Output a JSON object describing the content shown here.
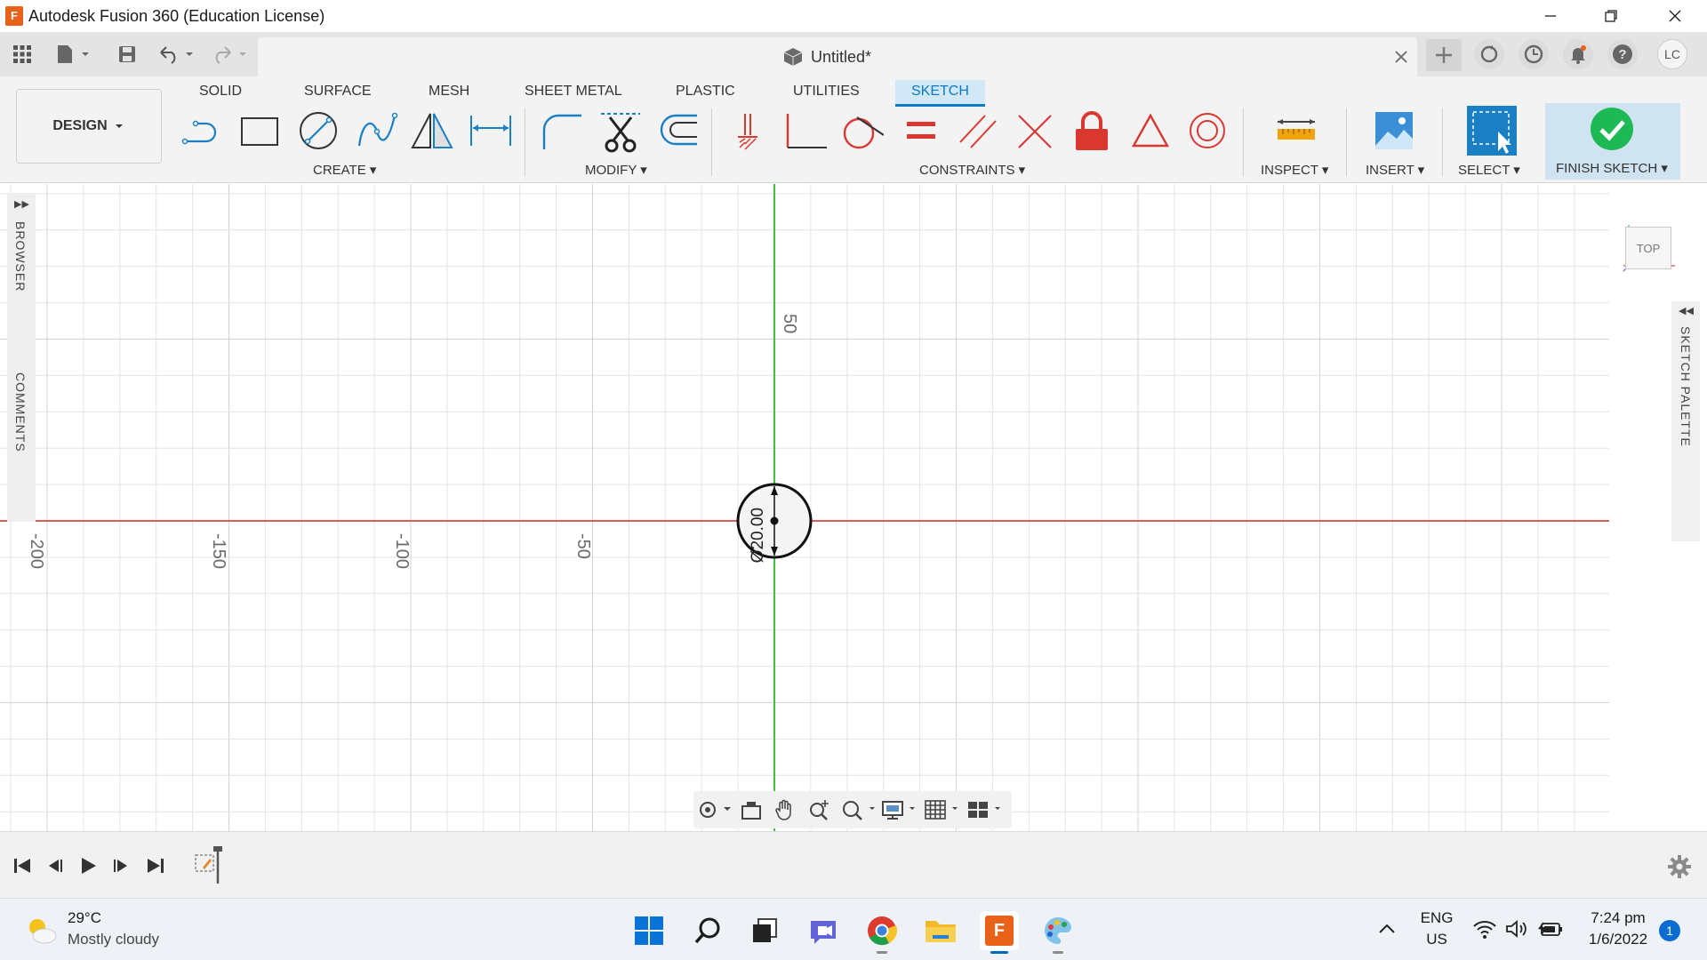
{
  "window": {
    "title": "Autodesk Fusion 360 (Education License)",
    "app_icon_letter": "F"
  },
  "tabbar": {
    "document_name": "Untitled*",
    "user_initials": "LC"
  },
  "ribbon": {
    "workspace": "DESIGN",
    "tabs": [
      {
        "label": "SOLID",
        "active": false
      },
      {
        "label": "SURFACE",
        "active": false
      },
      {
        "label": "MESH",
        "active": false
      },
      {
        "label": "SHEET METAL",
        "active": false
      },
      {
        "label": "PLASTIC",
        "active": false
      },
      {
        "label": "UTILITIES",
        "active": false
      },
      {
        "label": "SKETCH",
        "active": true
      }
    ],
    "groups": {
      "create": "CREATE",
      "modify": "MODIFY",
      "constraints": "CONSTRAINTS",
      "inspect": "INSPECT",
      "insert": "INSERT",
      "select": "SELECT",
      "finish": "FINISH SKETCH"
    },
    "colors": {
      "accent": "#0a7bc2",
      "constraint_red": "#d9372f",
      "finish_green": "#1db954"
    }
  },
  "canvas": {
    "browser_label": "BROWSER",
    "comments_label": "COMMENTS",
    "sketch_palette_label": "SKETCH PALETTE",
    "view_cube_label": "TOP",
    "axis_ticks": {
      "x": [
        "-200",
        "-150",
        "-100",
        "-50"
      ],
      "y": [
        "50"
      ]
    },
    "dimension_label": "Ø20.00",
    "colors": {
      "x_axis": "#e05a5a",
      "y_axis": "#3fc43f",
      "grid": "#e4e4e4"
    }
  },
  "taskbar": {
    "weather_temp": "29°C",
    "weather_desc": "Mostly cloudy",
    "language": "ENG",
    "region": "US",
    "time": "7:24 pm",
    "date": "1/6/2022",
    "notification_count": "1"
  }
}
